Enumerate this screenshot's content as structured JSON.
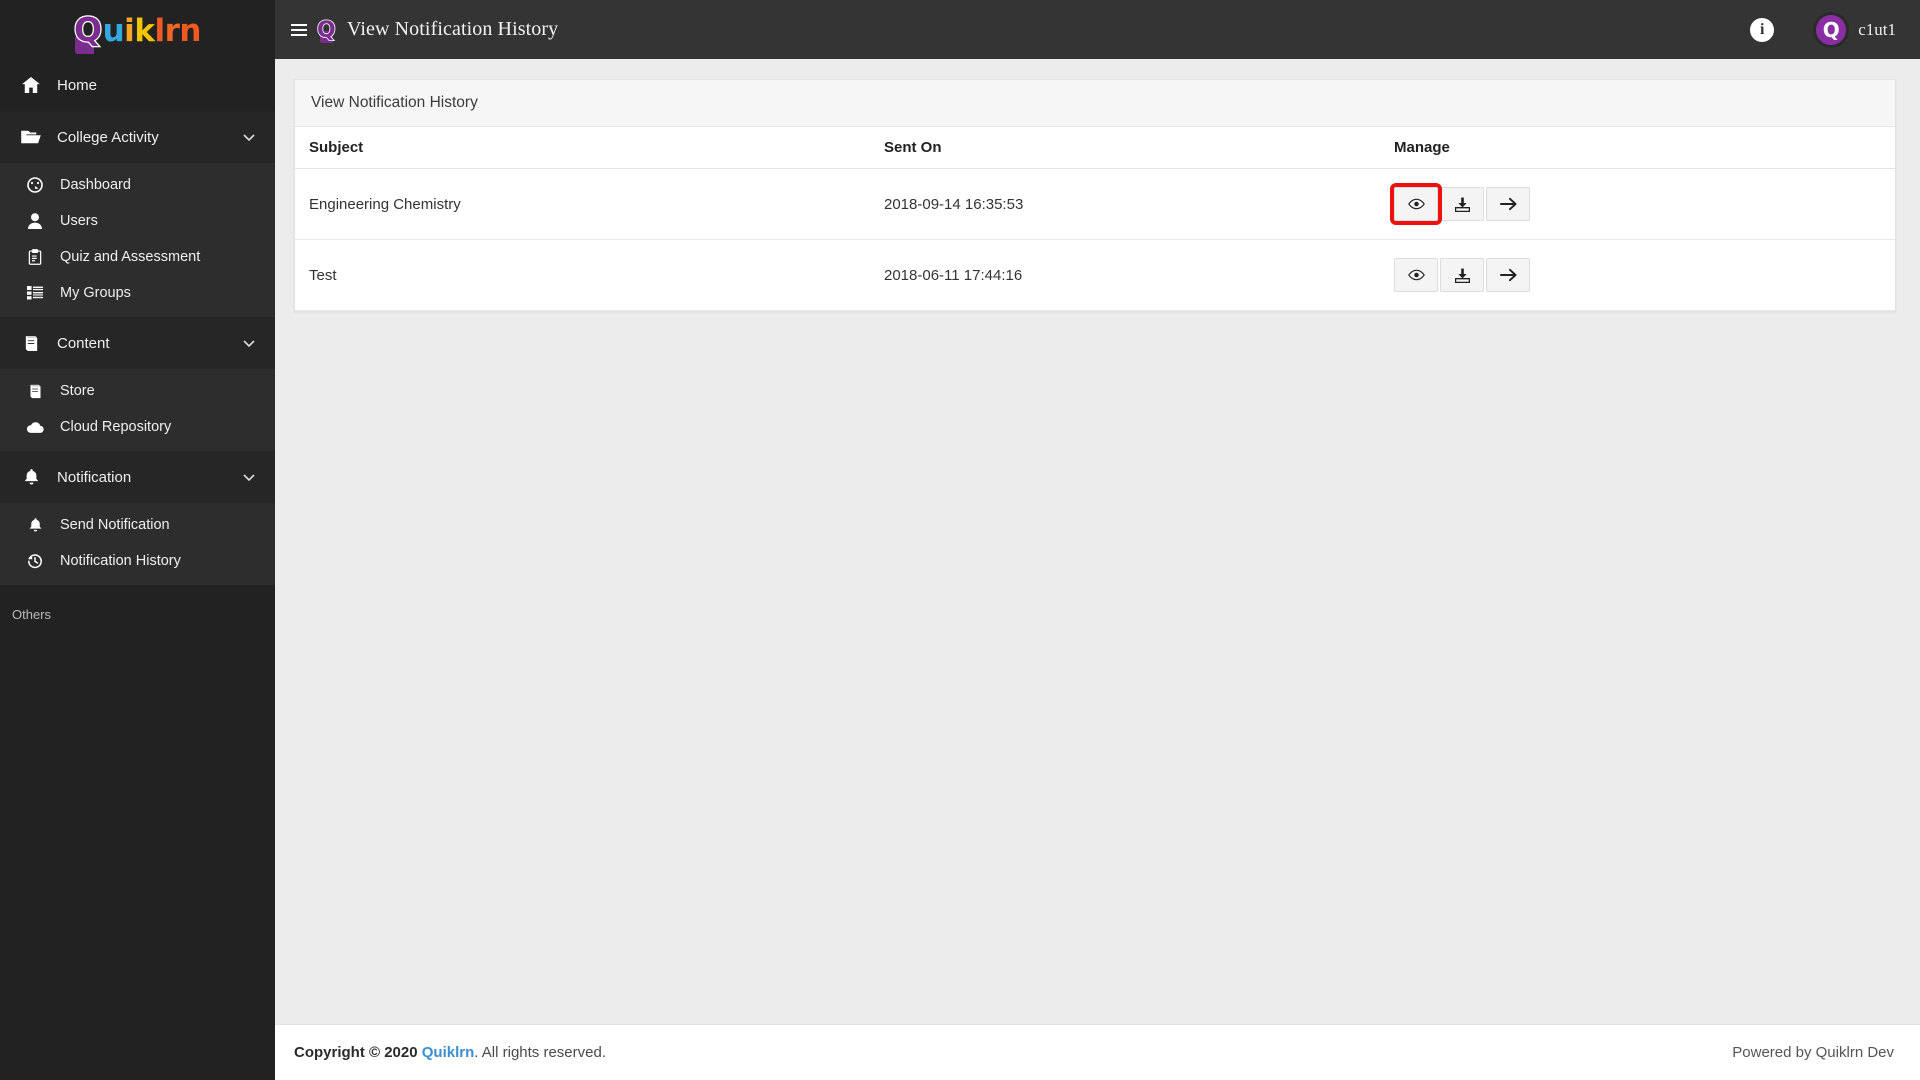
{
  "brand": {
    "logo_text": "Quiklrn",
    "logo_q": "Q",
    "logo_rest": "uiklrn",
    "colors": {
      "q": "#7b2d8e",
      "u": "#35a8e0",
      "i": "#f5a623",
      "k": "#f5c400",
      "l": "#f05a22",
      "r": "#f26522",
      "n": "#f05a22"
    }
  },
  "sidebar": {
    "items": [
      {
        "id": "home",
        "label": "Home",
        "icon": "home-icon",
        "type": "top",
        "expandable": false
      },
      {
        "id": "college-activity",
        "label": "College Activity",
        "icon": "folder-open-icon",
        "type": "top",
        "expandable": true,
        "chevron": "⌄"
      },
      {
        "id": "dashboard",
        "label": "Dashboard",
        "icon": "dashboard-icon",
        "type": "sub"
      },
      {
        "id": "users",
        "label": "Users",
        "icon": "user-icon",
        "type": "sub"
      },
      {
        "id": "quiz-and-assessment",
        "label": "Quiz and Assessment",
        "icon": "clipboard-check-icon",
        "type": "sub"
      },
      {
        "id": "my-groups",
        "label": "My Groups",
        "icon": "list-icon",
        "type": "sub"
      },
      {
        "id": "content",
        "label": "Content",
        "icon": "book-icon",
        "type": "top",
        "expandable": true,
        "chevron": "⌄"
      },
      {
        "id": "store",
        "label": "Store",
        "icon": "book-icon",
        "type": "sub"
      },
      {
        "id": "cloud-repository",
        "label": "Cloud Repository",
        "icon": "cloud-icon",
        "type": "sub"
      },
      {
        "id": "notification",
        "label": "Notification",
        "icon": "bell-icon",
        "type": "top",
        "expandable": true,
        "chevron": "⌄"
      },
      {
        "id": "send-notification",
        "label": "Send Notification",
        "icon": "bell-icon",
        "type": "sub"
      },
      {
        "id": "notification-history",
        "label": "Notification History",
        "icon": "history-icon",
        "type": "sub"
      }
    ],
    "others_label": "Others"
  },
  "topbar": {
    "menu_icon": "hamburger-icon",
    "logo_letter": "Q",
    "title": "View Notification History",
    "info_icon": "info-icon",
    "info_glyph": "i",
    "avatar_letter": "Q",
    "username": "c1ut1"
  },
  "main": {
    "card_title": "View Notification History",
    "table": {
      "columns": [
        "Subject",
        "Sent On",
        "Manage"
      ],
      "rows": [
        {
          "subject": "Engineering Chemistry",
          "sent_on": "2018-09-14 16:35:53",
          "actions": [
            {
              "name": "view-button",
              "icon": "eye-icon",
              "highlighted": true
            },
            {
              "name": "download-button",
              "icon": "download-icon",
              "highlighted": false
            },
            {
              "name": "forward-button",
              "icon": "arrow-right-icon",
              "highlighted": false
            }
          ]
        },
        {
          "subject": "Test",
          "sent_on": "2018-06-11 17:44:16",
          "actions": [
            {
              "name": "view-button",
              "icon": "eye-icon",
              "highlighted": false
            },
            {
              "name": "download-button",
              "icon": "download-icon",
              "highlighted": false
            },
            {
              "name": "forward-button",
              "icon": "arrow-right-icon",
              "highlighted": false
            }
          ]
        }
      ]
    },
    "highlight_color": "#ee1111"
  },
  "footer": {
    "copyright_prefix": "Copyright © 2020 ",
    "brand_link": "Quiklrn",
    "copyright_suffix": ". All rights reserved.",
    "powered_by": "Powered by Quiklrn Dev"
  }
}
